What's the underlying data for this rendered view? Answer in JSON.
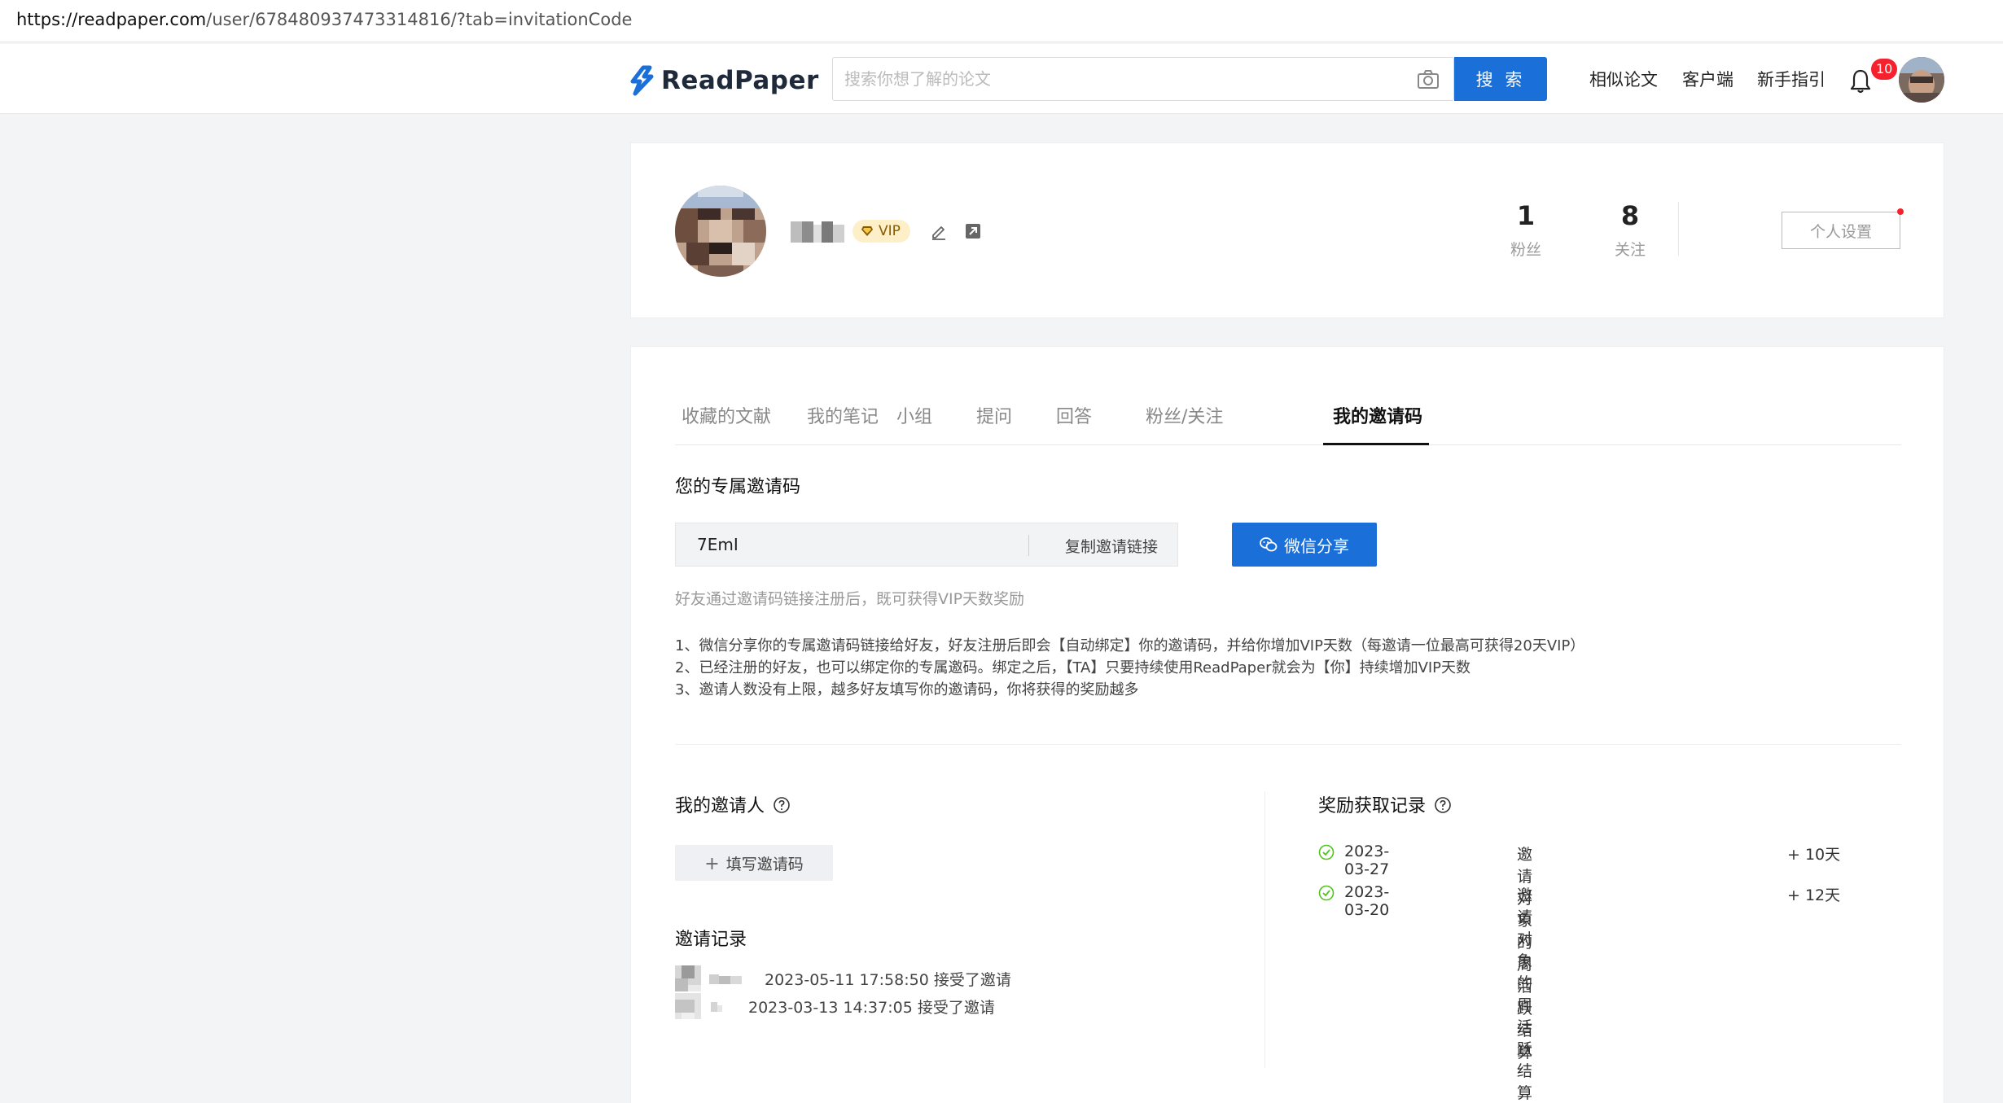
{
  "browser": {
    "url_host": "https://readpaper.com",
    "url_path": "/user/678480937473314816/?tab=invitationCode"
  },
  "nav": {
    "logo_text": "ReadPaper",
    "search_placeholder": "搜索你想了解的论文",
    "search_button": "搜 索",
    "links": [
      "相似论文",
      "客户端",
      "新手指引"
    ],
    "notification_count": "10"
  },
  "profile": {
    "vip_label": "VIP",
    "followers_count": "1",
    "followers_label": "粉丝",
    "following_count": "8",
    "following_label": "关注",
    "settings_button": "个人设置"
  },
  "tabs": [
    "收藏的文献",
    "我的笔记",
    "小组",
    "提问",
    "回答",
    "粉丝/关注",
    "我的邀请码"
  ],
  "active_tab": "我的邀请码",
  "invite": {
    "title": "您的专属邀请码",
    "code": "7EmI",
    "copy_button": "复制邀请链接",
    "wechat_button": "微信分享",
    "hint": "好友通过邀请码链接注册后，既可获得VIP天数奖励",
    "rules": [
      "1、微信分享你的专属邀请码链接给好友，好友注册后即会【自动绑定】你的邀请码，并给你增加VIP天数（每邀请一位最高可获得20天VIP）",
      "2、已经注册的好友，也可以绑定你的专属邀码。绑定之后，【TA】只要持续使用ReadPaper就会为【你】持续增加VIP天数",
      "3、邀请人数没有上限，越多好友填写你的邀请码，你将获得的奖励越多"
    ]
  },
  "my_inviter": {
    "title": "我的邀请人",
    "fill_button": "填写邀请码"
  },
  "invite_records": {
    "title": "邀请记录",
    "items": [
      {
        "text": "2023-05-11 17:58:50 接受了邀请"
      },
      {
        "text": "2023-03-13 14:37:05 接受了邀请"
      }
    ]
  },
  "reward_records": {
    "title": "奖励获取记录",
    "items": [
      {
        "date": "2023-03-27",
        "desc": "邀请对象的周活跃结算",
        "amount": "+ 10天"
      },
      {
        "date": "2023-03-20",
        "desc": "邀请对象的周活跃结算",
        "amount": "+ 12天"
      }
    ]
  },
  "colors": {
    "primary": "#1a6fd8",
    "badge": "#f5222d",
    "vip_bg": "#fdf0c9",
    "success": "#52c41a"
  }
}
